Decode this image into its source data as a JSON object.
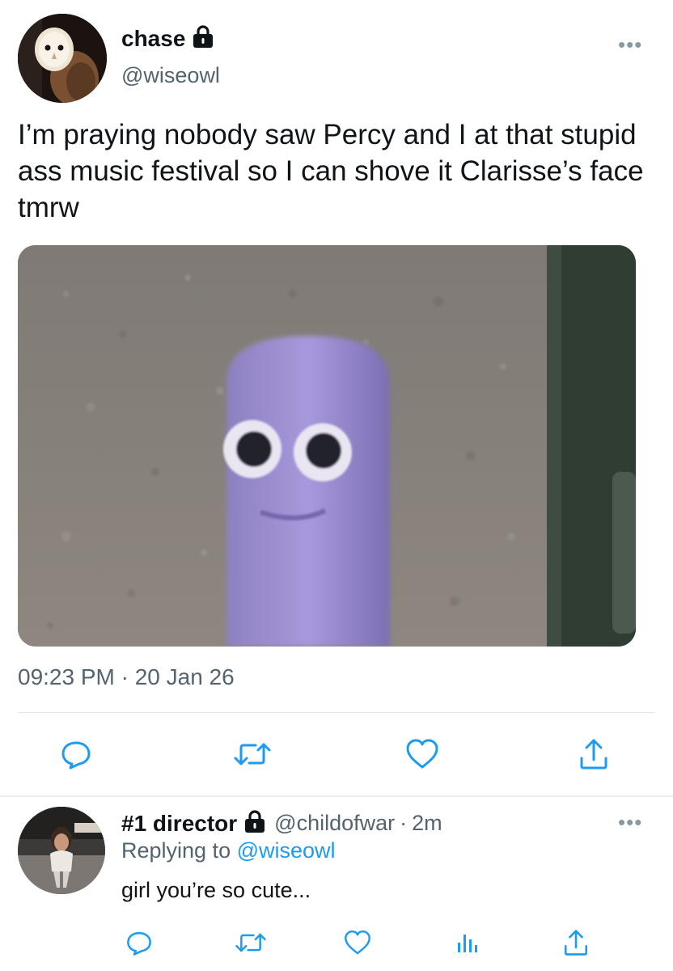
{
  "tweet": {
    "display_name": "chase",
    "handle": "@wiseowl",
    "text": "I’m praying nobody saw Percy and I at that stupid ass music festival so I can shove it Clarisse’s face tmrw",
    "timestamp": "09:23 PM · 20 Jan 26",
    "more": "•••"
  },
  "reply": {
    "display_name": "#1 director",
    "handle": "@childofwar",
    "separator": "·",
    "time": "2m",
    "replying_prefix": "Replying to",
    "replying_to": "@wiseowl",
    "text": "girl you’re so cute...",
    "more": "•••"
  },
  "colors": {
    "accent": "#1d9bf0",
    "secondary_text": "#536471",
    "icon_gray": "#1d9bf0"
  },
  "icons": {
    "main_actions": [
      "reply-icon",
      "retweet-icon",
      "like-icon",
      "share-icon"
    ],
    "reply_actions": [
      "reply-icon",
      "retweet-icon",
      "like-icon",
      "analytics-icon",
      "share-icon"
    ]
  }
}
